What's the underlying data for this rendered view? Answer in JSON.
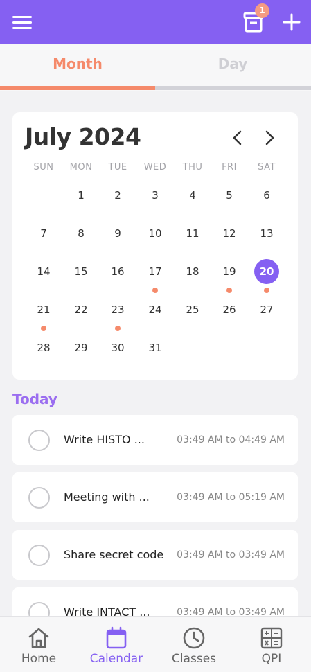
{
  "header": {
    "archive_badge": "1",
    "accent_color": "#8560f2"
  },
  "tabs": [
    {
      "label": "Month",
      "active": true
    },
    {
      "label": "Day",
      "active": false
    }
  ],
  "calendar": {
    "month_title": "July 2024",
    "weekdays": [
      "SUN",
      "MON",
      "TUE",
      "WED",
      "THU",
      "FRI",
      "SAT"
    ],
    "first_weekday_index": 1,
    "days_in_month": 31,
    "selected_day": 20,
    "days_with_events": [
      17,
      19,
      20,
      21,
      23
    ],
    "event_dot_color": "#f58a6b"
  },
  "today": {
    "title": "Today",
    "tasks": [
      {
        "title": "Write HISTO ...",
        "time": "03:49 AM to 04:49 AM"
      },
      {
        "title": "Meeting with ...",
        "time": "03:49 AM to 05:19 AM"
      },
      {
        "title": "Share secret code",
        "time": "03:49 AM to 03:49 AM"
      },
      {
        "title": "Write INTACT ...",
        "time": "03:49 AM to 03:49 AM"
      }
    ]
  },
  "bottom_nav": [
    {
      "label": "Home",
      "icon": "home-icon",
      "active": false
    },
    {
      "label": "Calendar",
      "icon": "calendar-icon",
      "active": true
    },
    {
      "label": "Classes",
      "icon": "clock-icon",
      "active": false
    },
    {
      "label": "QPI",
      "icon": "calculator-icon",
      "active": false
    }
  ]
}
